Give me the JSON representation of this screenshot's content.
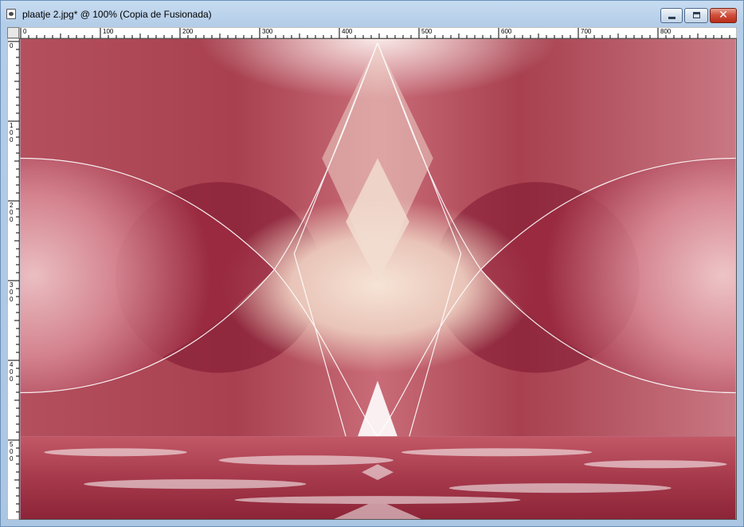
{
  "window": {
    "title": "plaatje 2.jpg* @ 100% (Copia de Fusionada)",
    "controls": {
      "minimize": "minimize-button",
      "maximize": "maximize-button",
      "close": "✕"
    }
  },
  "rulers": {
    "horizontal_labels": [
      "0",
      "100",
      "200",
      "300",
      "400",
      "500",
      "600",
      "700",
      "800"
    ],
    "vertical_labels": [
      [
        "0"
      ],
      [
        "1",
        "0",
        "0"
      ],
      [
        "2",
        "0",
        "0"
      ],
      [
        "3",
        "0",
        "0"
      ],
      [
        "4",
        "0",
        "0"
      ],
      [
        "5",
        "0",
        "0"
      ]
    ]
  },
  "colors": {
    "title_bar": "#b9d1ea",
    "ruler_bg": "#ffffff",
    "ruler_ink": "#000000",
    "canvas_main": "#b84e5e",
    "canvas_light": "#f3d9cf",
    "canvas_dark": "#8a1d35",
    "close_button": "#c8412c"
  },
  "icons": [
    "document-icon",
    "minimize-icon",
    "maximize-icon",
    "close-icon"
  ]
}
